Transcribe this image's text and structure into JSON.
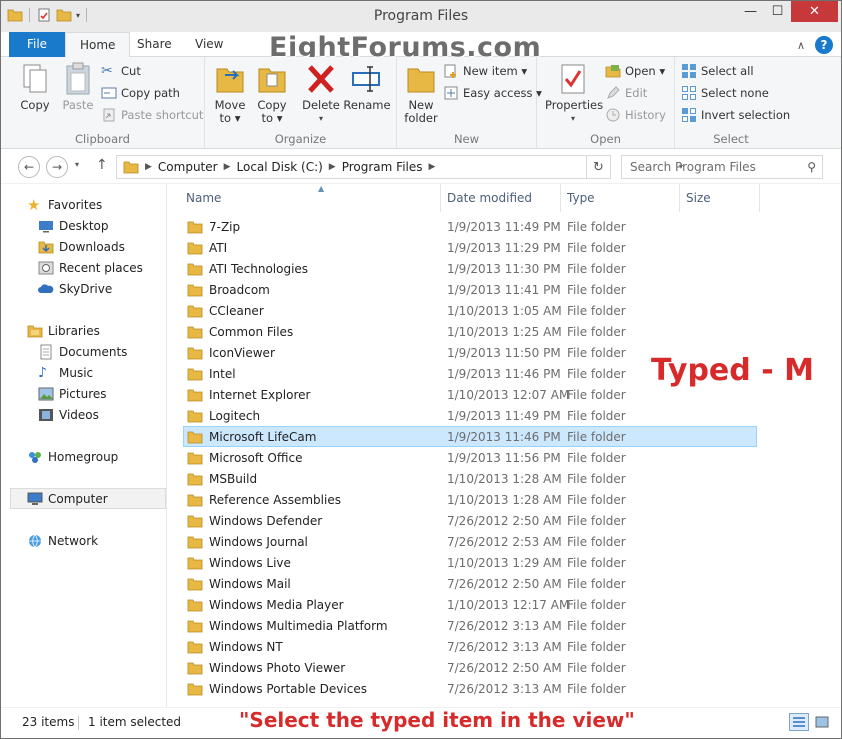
{
  "window": {
    "title": "Program Files",
    "controls": {
      "minimize": "—",
      "maximize": "☐",
      "close": "✕"
    }
  },
  "watermark": "EightForums.com",
  "tabs": {
    "file": "File",
    "home": "Home",
    "share": "Share",
    "view": "View"
  },
  "ribbon": {
    "clipboard": {
      "label": "Clipboard",
      "copy": "Copy",
      "paste": "Paste",
      "cut": "Cut",
      "copy_path": "Copy path",
      "paste_shortcut": "Paste shortcut"
    },
    "organize": {
      "label": "Organize",
      "move_to": [
        "Move",
        "to ▾"
      ],
      "copy_to": [
        "Copy",
        "to ▾"
      ],
      "delete": "Delete",
      "rename": "Rename"
    },
    "new": {
      "label": "New",
      "new_folder": [
        "New",
        "folder"
      ],
      "new_item": "New item ▾",
      "easy_access": "Easy access ▾"
    },
    "open": {
      "label": "Open",
      "properties": "Properties",
      "open": "Open ▾",
      "edit": "Edit",
      "history": "History"
    },
    "select": {
      "label": "Select",
      "select_all": "Select all",
      "select_none": "Select none",
      "invert_selection": "Invert selection"
    }
  },
  "address": {
    "crumbs": [
      "Computer",
      "Local Disk (C:)",
      "Program Files"
    ],
    "search_placeholder": "Search Program Files"
  },
  "nav": {
    "favorites": "Favorites",
    "desktop": "Desktop",
    "downloads": "Downloads",
    "recent_places": "Recent places",
    "skydrive": "SkyDrive",
    "libraries": "Libraries",
    "documents": "Documents",
    "music": "Music",
    "pictures": "Pictures",
    "videos": "Videos",
    "homegroup": "Homegroup",
    "computer": "Computer",
    "network": "Network"
  },
  "columns": {
    "name": "Name",
    "date": "Date modified",
    "type": "Type",
    "size": "Size"
  },
  "files": [
    {
      "name": "7-Zip",
      "date": "1/9/2013 11:49 PM",
      "type": "File folder"
    },
    {
      "name": "ATI",
      "date": "1/9/2013 11:29 PM",
      "type": "File folder"
    },
    {
      "name": "ATI Technologies",
      "date": "1/9/2013 11:30 PM",
      "type": "File folder"
    },
    {
      "name": "Broadcom",
      "date": "1/9/2013 11:41 PM",
      "type": "File folder"
    },
    {
      "name": "CCleaner",
      "date": "1/10/2013 1:05 AM",
      "type": "File folder"
    },
    {
      "name": "Common Files",
      "date": "1/10/2013 1:25 AM",
      "type": "File folder"
    },
    {
      "name": "IconViewer",
      "date": "1/9/2013 11:50 PM",
      "type": "File folder"
    },
    {
      "name": "Intel",
      "date": "1/9/2013 11:46 PM",
      "type": "File folder"
    },
    {
      "name": "Internet Explorer",
      "date": "1/10/2013 12:07 AM",
      "type": "File folder"
    },
    {
      "name": "Logitech",
      "date": "1/9/2013 11:49 PM",
      "type": "File folder"
    },
    {
      "name": "Microsoft LifeCam",
      "date": "1/9/2013 11:46 PM",
      "type": "File folder",
      "selected": true
    },
    {
      "name": "Microsoft Office",
      "date": "1/9/2013 11:56 PM",
      "type": "File folder"
    },
    {
      "name": "MSBuild",
      "date": "1/10/2013 1:28 AM",
      "type": "File folder"
    },
    {
      "name": "Reference Assemblies",
      "date": "1/10/2013 1:28 AM",
      "type": "File folder"
    },
    {
      "name": "Windows Defender",
      "date": "7/26/2012 2:50 AM",
      "type": "File folder"
    },
    {
      "name": "Windows Journal",
      "date": "7/26/2012 2:53 AM",
      "type": "File folder"
    },
    {
      "name": "Windows Live",
      "date": "1/10/2013 1:29 AM",
      "type": "File folder"
    },
    {
      "name": "Windows Mail",
      "date": "7/26/2012 2:50 AM",
      "type": "File folder"
    },
    {
      "name": "Windows Media Player",
      "date": "1/10/2013 12:17 AM",
      "type": "File folder"
    },
    {
      "name": "Windows Multimedia Platform",
      "date": "7/26/2012 3:13 AM",
      "type": "File folder"
    },
    {
      "name": "Windows NT",
      "date": "7/26/2012 3:13 AM",
      "type": "File folder"
    },
    {
      "name": "Windows Photo Viewer",
      "date": "7/26/2012 2:50 AM",
      "type": "File folder"
    },
    {
      "name": "Windows Portable Devices",
      "date": "7/26/2012 3:13 AM",
      "type": "File folder"
    }
  ],
  "annotation_typed": "Typed - M",
  "status": {
    "items": "23 items",
    "selected": "1 item selected",
    "caption": "\"Select the typed item in the view\""
  },
  "colors": {
    "accent": "#1979ca",
    "close": "#c7383a",
    "selection_bg": "#cce8ff",
    "selection_border": "#99d1ff",
    "annotation": "#d72b2b",
    "folder": "#e8b845"
  }
}
